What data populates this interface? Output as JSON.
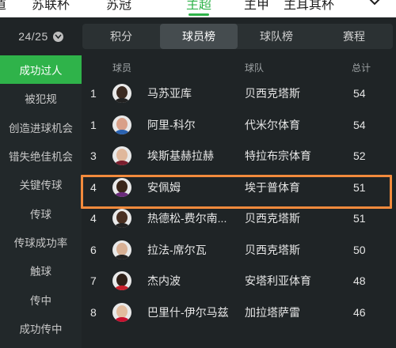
{
  "league_tabs": [
    {
      "label": "道"
    },
    {
      "label": "苏联杯"
    },
    {
      "label": "苏冠"
    },
    {
      "label": "主超"
    },
    {
      "label": "主甲"
    },
    {
      "label": "主耳其杯"
    }
  ],
  "season": {
    "label": "24/25"
  },
  "subtabs": [
    {
      "label": "积分"
    },
    {
      "label": "球员榜"
    },
    {
      "label": "球队榜"
    },
    {
      "label": "赛程"
    }
  ],
  "sidebar": {
    "items": [
      {
        "label": "成功过人"
      },
      {
        "label": "被犯规"
      },
      {
        "label": "创造进球机会"
      },
      {
        "label": "错失绝佳机会"
      },
      {
        "label": "关键传球"
      },
      {
        "label": "传球"
      },
      {
        "label": "传球成功率"
      },
      {
        "label": "触球"
      },
      {
        "label": "传中"
      },
      {
        "label": "成功传中"
      }
    ]
  },
  "table": {
    "headers": {
      "player": "球员",
      "team": "球队",
      "total": "总计"
    },
    "rows": [
      {
        "rank": "1",
        "player": "马苏亚库",
        "team": "贝西克塔斯",
        "total": "54",
        "skin": "#3b2a20",
        "shirt": "#222222"
      },
      {
        "rank": "1",
        "player": "阿里-科尔",
        "team": "代米尔体育",
        "total": "54",
        "skin": "#d9a088",
        "shirt": "#2a62b0"
      },
      {
        "rank": "3",
        "player": "埃斯基赫拉赫",
        "team": "特拉布宗体育",
        "total": "52",
        "skin": "#e0b89c",
        "shirt": "#7a1e2e"
      },
      {
        "rank": "4",
        "player": "安佩姆",
        "team": "埃于普体育",
        "total": "51",
        "skin": "#3a2619",
        "shirt": "#6a2a7a"
      },
      {
        "rank": "4",
        "player": "热德松-费尔南...",
        "team": "贝西克塔斯",
        "total": "51",
        "skin": "#4a3022",
        "shirt": "#222222"
      },
      {
        "rank": "6",
        "player": "拉法-席尔瓦",
        "team": "贝西克塔斯",
        "total": "50",
        "skin": "#d8b094",
        "shirt": "#222222"
      },
      {
        "rank": "7",
        "player": "杰内波",
        "team": "安塔利亚体育",
        "total": "48",
        "skin": "#2f2018",
        "shirt": "#c81e2a"
      },
      {
        "rank": "8",
        "player": "巴里什-伊尔马兹",
        "team": "加拉塔萨雷",
        "total": "46",
        "skin": "#e2bc9e",
        "shirt": "#c8102e"
      }
    ]
  },
  "colors": {
    "accent": "#2fb34a",
    "highlight": "#f28a3c",
    "background": "#1f2426"
  }
}
